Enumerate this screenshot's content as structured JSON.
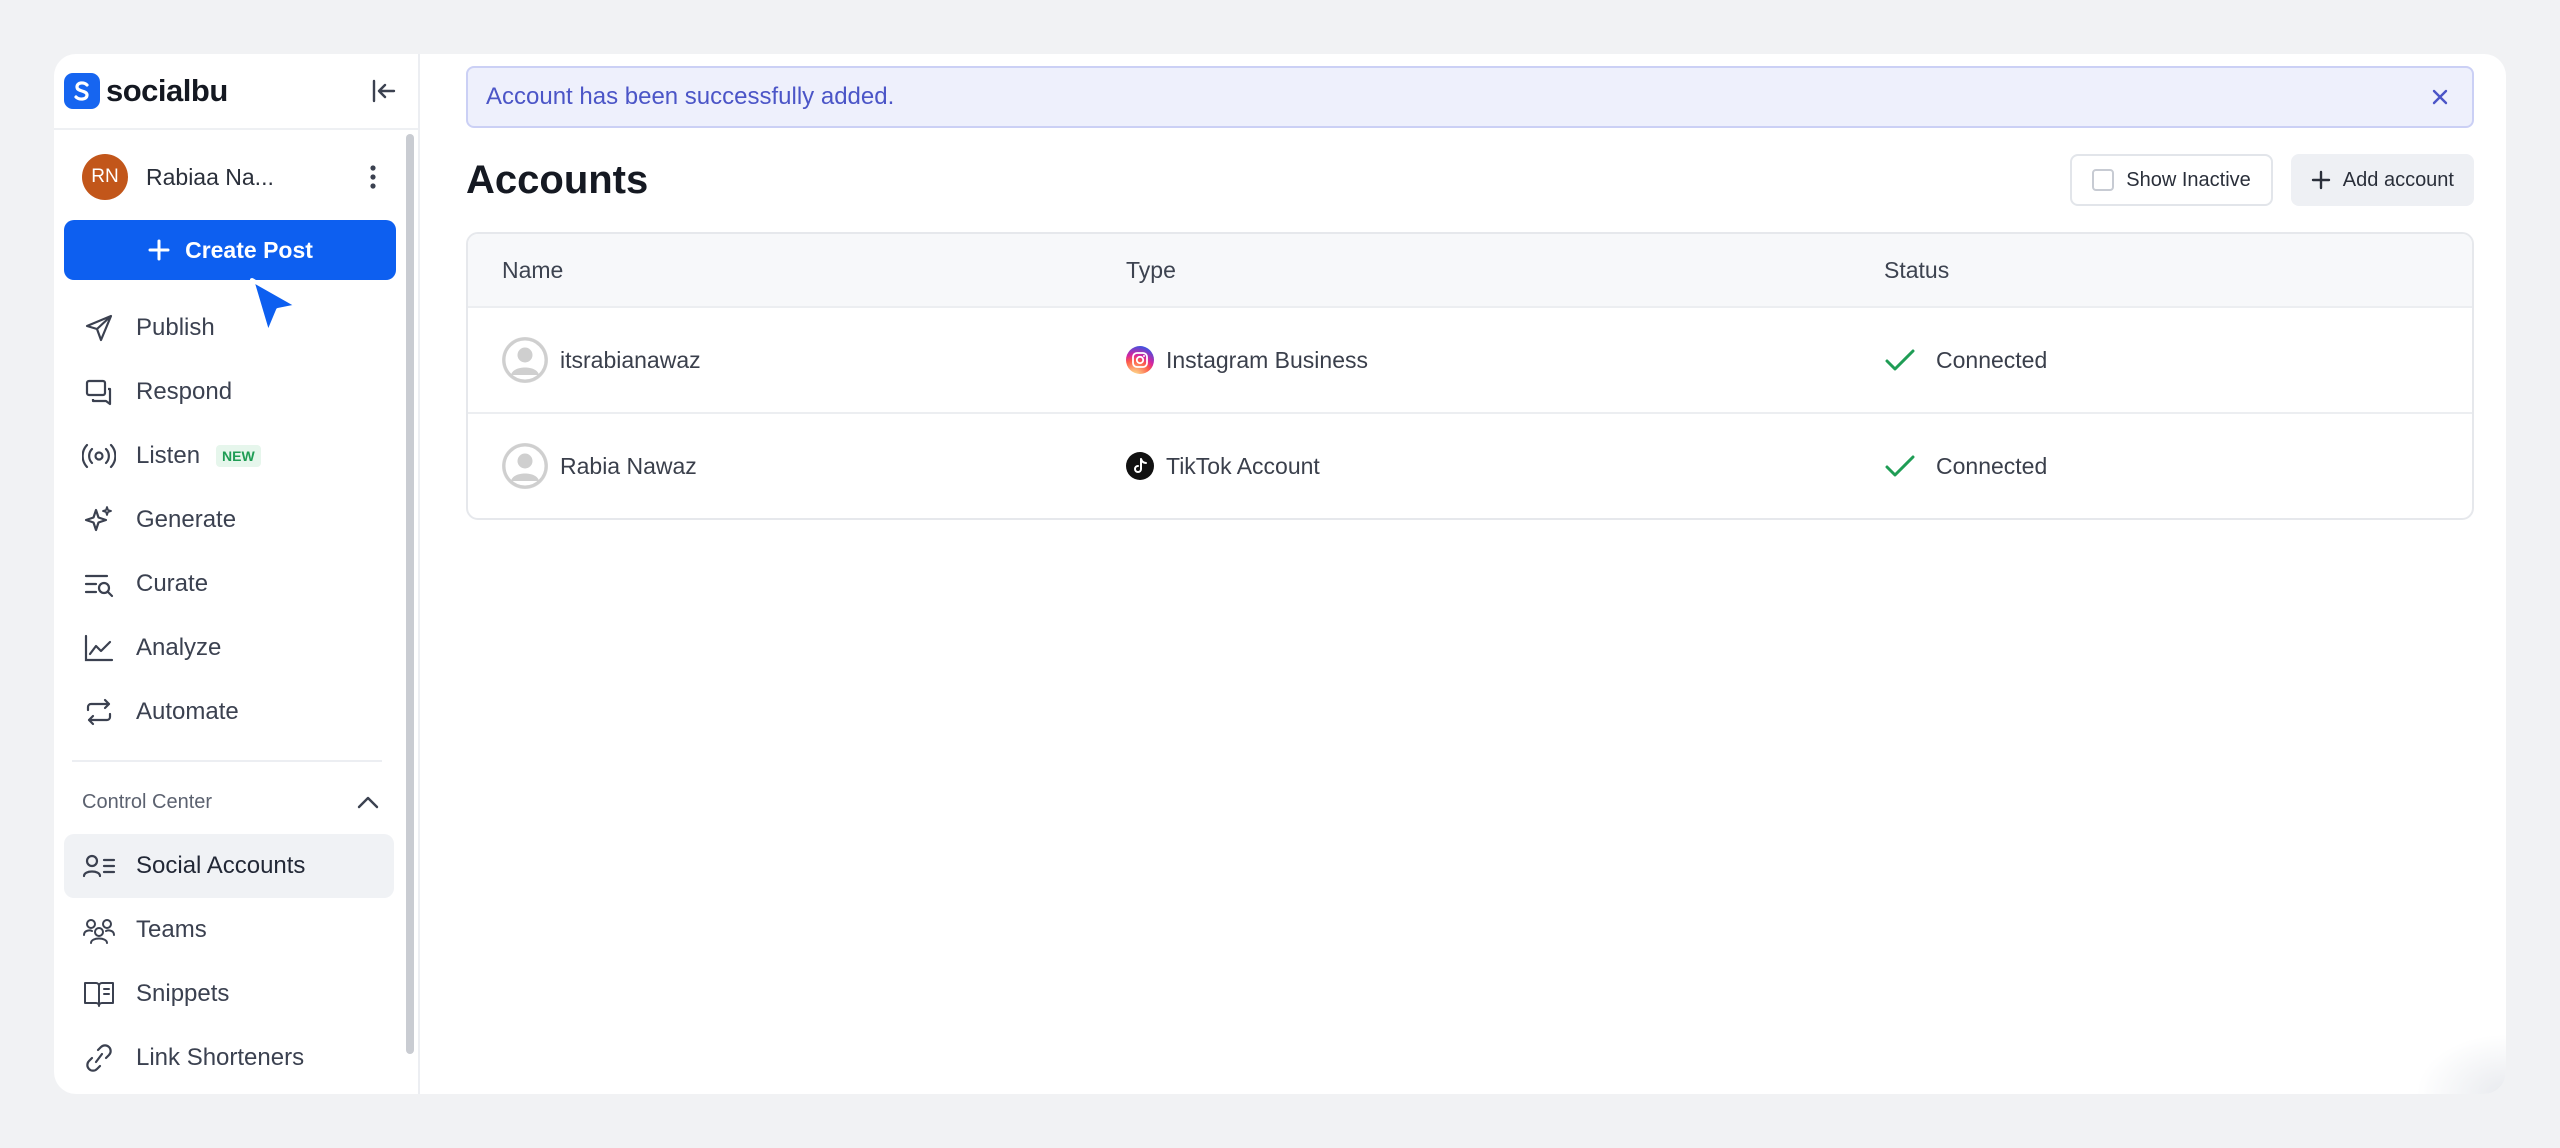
{
  "brand": {
    "name": "socialbu",
    "accent": "#0d5ff0"
  },
  "user": {
    "initials": "RN",
    "name": "Rabiaa Na...",
    "avatar_color": "#c2561a"
  },
  "sidebar": {
    "create_label": "Create Post",
    "nav": [
      {
        "label": "Publish",
        "icon": "paper-plane-icon"
      },
      {
        "label": "Respond",
        "icon": "chat-bubbles-icon"
      },
      {
        "label": "Listen",
        "icon": "broadcast-icon",
        "badge": "NEW"
      },
      {
        "label": "Generate",
        "icon": "sparkles-icon"
      },
      {
        "label": "Curate",
        "icon": "filter-search-icon"
      },
      {
        "label": "Analyze",
        "icon": "line-chart-icon"
      },
      {
        "label": "Automate",
        "icon": "repeat-icon"
      }
    ],
    "section_title": "Control Center",
    "section_items": [
      {
        "label": "Social Accounts",
        "icon": "user-list-icon",
        "active": true
      },
      {
        "label": "Teams",
        "icon": "team-icon"
      },
      {
        "label": "Snippets",
        "icon": "book-icon"
      },
      {
        "label": "Link Shorteners",
        "icon": "link-icon"
      }
    ]
  },
  "alert": {
    "message": "Account has been successfully added."
  },
  "page": {
    "title": "Accounts",
    "show_inactive_label": "Show Inactive",
    "add_account_label": "Add account"
  },
  "table": {
    "headers": [
      "Name",
      "Type",
      "Status"
    ],
    "rows": [
      {
        "name": "itsrabianawaz",
        "type": "Instagram Business",
        "type_icon": "instagram-icon",
        "status": "Connected"
      },
      {
        "name": "Rabia Nawaz",
        "type": "TikTok Account",
        "type_icon": "tiktok-icon",
        "status": "Connected"
      }
    ]
  },
  "colors": {
    "status_ok": "#1f9d55",
    "alert_text": "#4b55c7"
  }
}
